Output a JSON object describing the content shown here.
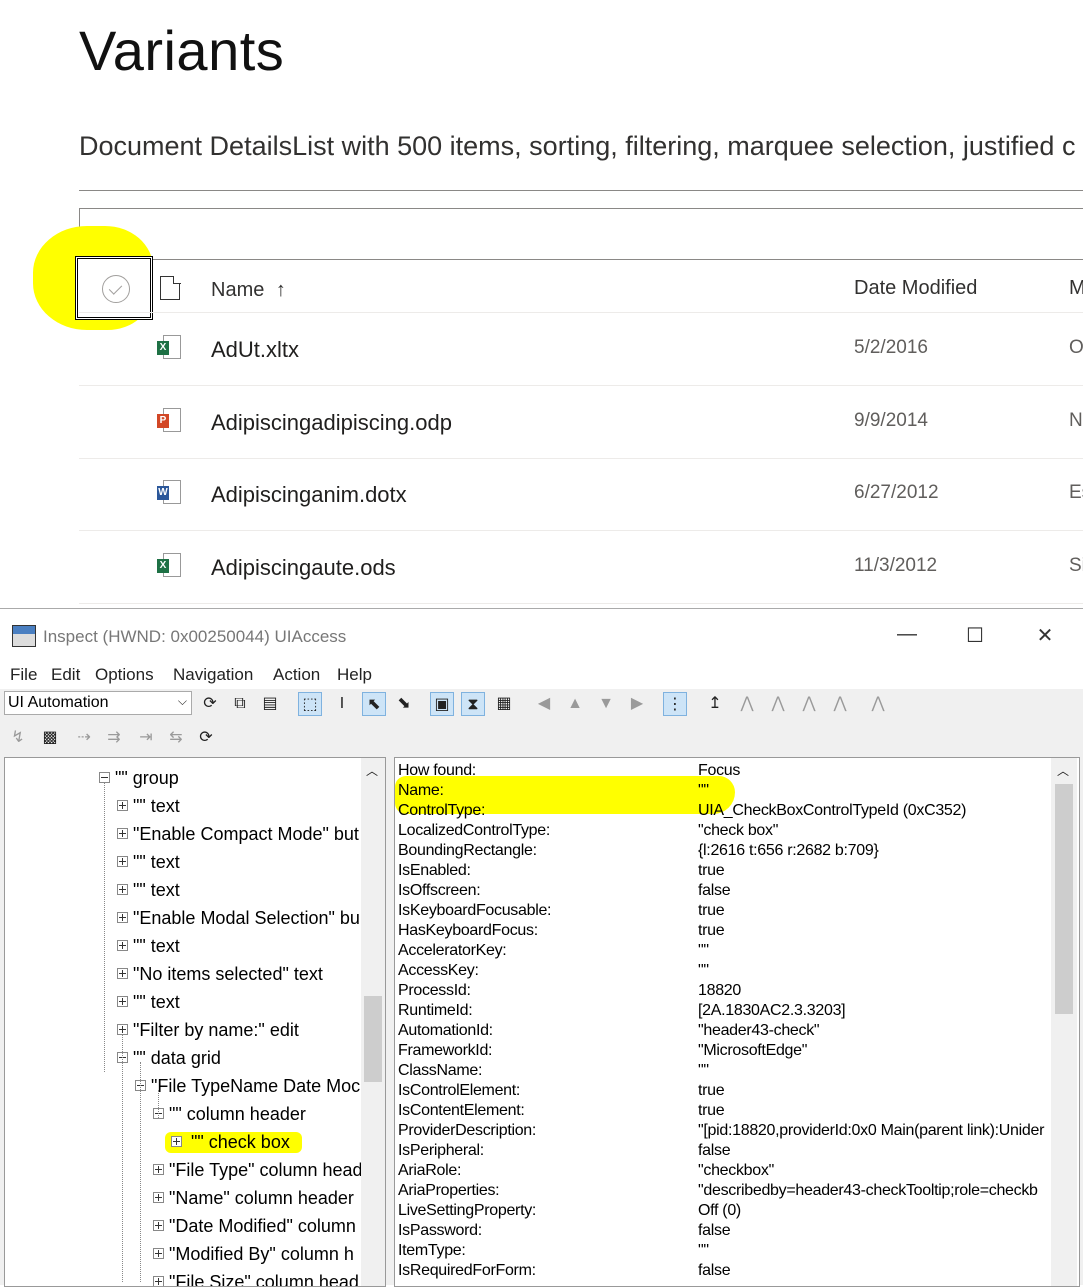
{
  "page": {
    "title": "Variants",
    "description": "Document DetailsList with 500 items, sorting, filtering, marquee selection, justified c"
  },
  "details_list": {
    "columns": {
      "name": "Name",
      "sort_glyph": "↑",
      "date": "Date Modified",
      "modified_by": "M"
    },
    "rows": [
      {
        "name": "AdUt.xltx",
        "date": "5/2/2016",
        "by": "O",
        "type": "excel"
      },
      {
        "name": "Adipiscingadipiscing.odp",
        "date": "9/9/2014",
        "by": "N",
        "type": "powerpoint"
      },
      {
        "name": "Adipiscinganim.dotx",
        "date": "6/27/2012",
        "by": "Es",
        "type": "word"
      },
      {
        "name": "Adipiscingaute.ods",
        "date": "11/3/2012",
        "by": "Si",
        "type": "excel-sync"
      }
    ],
    "icon_badges": {
      "excel": "X",
      "powerpoint": "P",
      "word": "W"
    },
    "highlight_color": "#ffff00"
  },
  "inspect": {
    "title": "Inspect  (HWND: 0x00250044) UIAccess",
    "window_controls": {
      "minimize": "—",
      "maximize": "☐",
      "close": "✕"
    },
    "menu": [
      "File",
      "Edit",
      "Options",
      "Navigation",
      "Action",
      "Help"
    ],
    "mode_select": "UI Automation",
    "tree": [
      {
        "label": "\"\" group",
        "state": "minus"
      },
      {
        "label": "\"\" text",
        "state": "plus"
      },
      {
        "label": "\"Enable Compact Mode\" but",
        "state": "plus"
      },
      {
        "label": "\"\" text",
        "state": "plus"
      },
      {
        "label": "\"\" text",
        "state": "plus"
      },
      {
        "label": "\"Enable Modal Selection\" bu",
        "state": "plus"
      },
      {
        "label": "\"\" text",
        "state": "plus"
      },
      {
        "label": "\"No items selected\" text",
        "state": "plus"
      },
      {
        "label": "\"\" text",
        "state": "plus"
      },
      {
        "label": "\"Filter by name:\" edit",
        "state": "plus"
      },
      {
        "label": "\"\" data grid",
        "state": "minus"
      },
      {
        "label": "\"File TypeName Date Moc",
        "state": "minus"
      },
      {
        "label": "\"\" column header",
        "state": "minus"
      },
      {
        "label": "\"\" check box",
        "state": "plus",
        "selected": true
      },
      {
        "label": "\"File Type\" column head",
        "state": "plus"
      },
      {
        "label": "\"Name\" column header",
        "state": "plus"
      },
      {
        "label": "\"Date Modified\" column",
        "state": "plus"
      },
      {
        "label": "\"Modified By\" column h",
        "state": "plus"
      },
      {
        "label": "\"File Size\" column head",
        "state": "plus"
      }
    ],
    "properties": [
      {
        "k": "How found:",
        "v": "Focus"
      },
      {
        "k": "Name:",
        "v": "\"\""
      },
      {
        "k": "ControlType:",
        "v": "UIA_CheckBoxControlTypeId (0xC352)"
      },
      {
        "k": "LocalizedControlType:",
        "v": "\"check box\""
      },
      {
        "k": "BoundingRectangle:",
        "v": "{l:2616 t:656 r:2682 b:709}"
      },
      {
        "k": "IsEnabled:",
        "v": "true"
      },
      {
        "k": "IsOffscreen:",
        "v": "false"
      },
      {
        "k": "IsKeyboardFocusable:",
        "v": "true"
      },
      {
        "k": "HasKeyboardFocus:",
        "v": "true"
      },
      {
        "k": "AcceleratorKey:",
        "v": "\"\""
      },
      {
        "k": "AccessKey:",
        "v": "\"\""
      },
      {
        "k": "ProcessId:",
        "v": "18820"
      },
      {
        "k": "RuntimeId:",
        "v": "[2A.1830AC2.3.3203]"
      },
      {
        "k": "AutomationId:",
        "v": "\"header43-check\""
      },
      {
        "k": "FrameworkId:",
        "v": "\"MicrosoftEdge\""
      },
      {
        "k": "ClassName:",
        "v": "\"\""
      },
      {
        "k": "IsControlElement:",
        "v": "true"
      },
      {
        "k": "IsContentElement:",
        "v": "true"
      },
      {
        "k": "ProviderDescription:",
        "v": "\"[pid:18820,providerId:0x0 Main(parent link):Unider"
      },
      {
        "k": "IsPeripheral:",
        "v": "false"
      },
      {
        "k": "AriaRole:",
        "v": "\"checkbox\""
      },
      {
        "k": "AriaProperties:",
        "v": "\"describedby=header43-checkTooltip;role=checkb"
      },
      {
        "k": "LiveSettingProperty:",
        "v": "Off (0)"
      },
      {
        "k": "IsPassword:",
        "v": "false"
      },
      {
        "k": "ItemType:",
        "v": "\"\""
      },
      {
        "k": "IsRequiredForForm:",
        "v": "false"
      }
    ]
  }
}
